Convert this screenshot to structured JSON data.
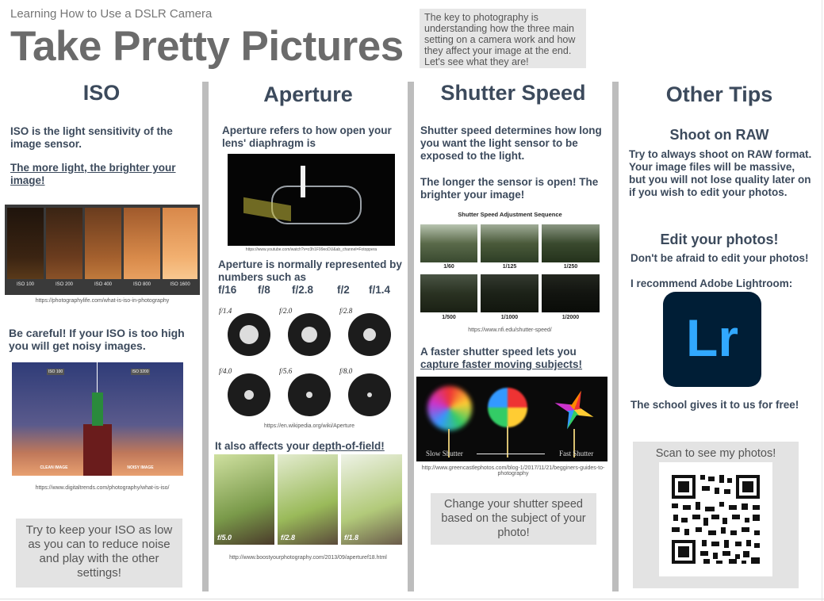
{
  "header": {
    "kicker": "Learning How to Use a DSLR Camera",
    "title": "Take Pretty Pictures",
    "intro": "The key to photography is understanding how the three main setting on a camera work and how they affect your image at the end. Let's see what they are!"
  },
  "iso": {
    "heading": "ISO",
    "definition": "ISO is the light sensitivity of the image sensor.",
    "rule": "The more light, the brighter your image!",
    "strip_labels": [
      "ISO 100",
      "ISO 200",
      "ISO 400",
      "ISO 800",
      "ISO 1600"
    ],
    "url1": "https://photographylife.com/what-is-iso-in-photography",
    "warning": "Be careful! If your ISO is too high you will get noisy images.",
    "noise_labels": [
      "ISO 100",
      "ISO 3200",
      "CLEAN IMAGE",
      "NOISY IMAGE"
    ],
    "url2": "https://www.digitaltrends.com/photography/what-is-iso/",
    "tip": "Try to keep your ISO as low as you can to reduce noise and play with the other settings!"
  },
  "aperture": {
    "heading": "Aperture",
    "definition": "Aperture refers to how open your lens' diaphragm is",
    "url1": "https://www.youtube.com/watch?v=z3h1F99eoDU&ab_channel=Fotoppera",
    "numbers_text": "Aperture is normally represented by numbers such as",
    "fstops": [
      "f/16",
      "f/8",
      "f/2.8",
      "f/2",
      "f/1.4"
    ],
    "lens_labels": [
      "f/1.4",
      "f/2.0",
      "f/2.8",
      "f/4.0",
      "f/5.6",
      "f/8.0"
    ],
    "url2": "https://en.wikipedia.org/wiki/Aperture",
    "dof_prefix": "It also affects your ",
    "dof_link": "depth-of-field!",
    "dof_labels": [
      "f/5.0",
      "f/2.8",
      "f/1.8"
    ],
    "url3": "http://www.boostyourphotography.com/2013/09/aperturef18.html"
  },
  "shutter": {
    "heading": "Shutter Speed",
    "definition": "Shutter speed determines how long you want the light sensor to be exposed to the light.",
    "longer": "The longer the sensor is open! The brighter your image!",
    "sequence_title": "Shutter Speed Adjustment Sequence",
    "speeds": [
      "1/60",
      "1/125",
      "1/250",
      "1/500",
      "1/1000",
      "1/2000"
    ],
    "url1": "https://www.nfi.edu/shutter-speed/",
    "faster_prefix": "A faster shutter speed lets you ",
    "faster_link": "capture faster moving subjects!",
    "slow_label": "Slow Shutter",
    "fast_label": "Fast Shutter",
    "url2": "http://www.greencastlephotos.com/blog-1/2017/11/21/begginers-guides-to-photography",
    "tip": "Change your shutter speed based on the subject of your photo!"
  },
  "tips": {
    "heading": "Other Tips",
    "raw_heading": "Shoot on RAW",
    "raw_text": "Try to always shoot on RAW format. Your image files will be massive, but you will not lose quality later on if you wish to edit your photos.",
    "edit_heading": "Edit your photos!",
    "edit_text": "Don't be afraid to edit your photos!",
    "recommend": "I recommend Adobe Lightroom:",
    "lr_logo": "Lr",
    "free": "The school gives it to us for free!",
    "scan": "Scan to see my photos!"
  },
  "colors": {
    "heading": "#3c4a5c",
    "divider": "#bdbdbd",
    "box": "#e3e3e3",
    "lr_bg": "#001e36",
    "lr_fg": "#31a8ff"
  }
}
